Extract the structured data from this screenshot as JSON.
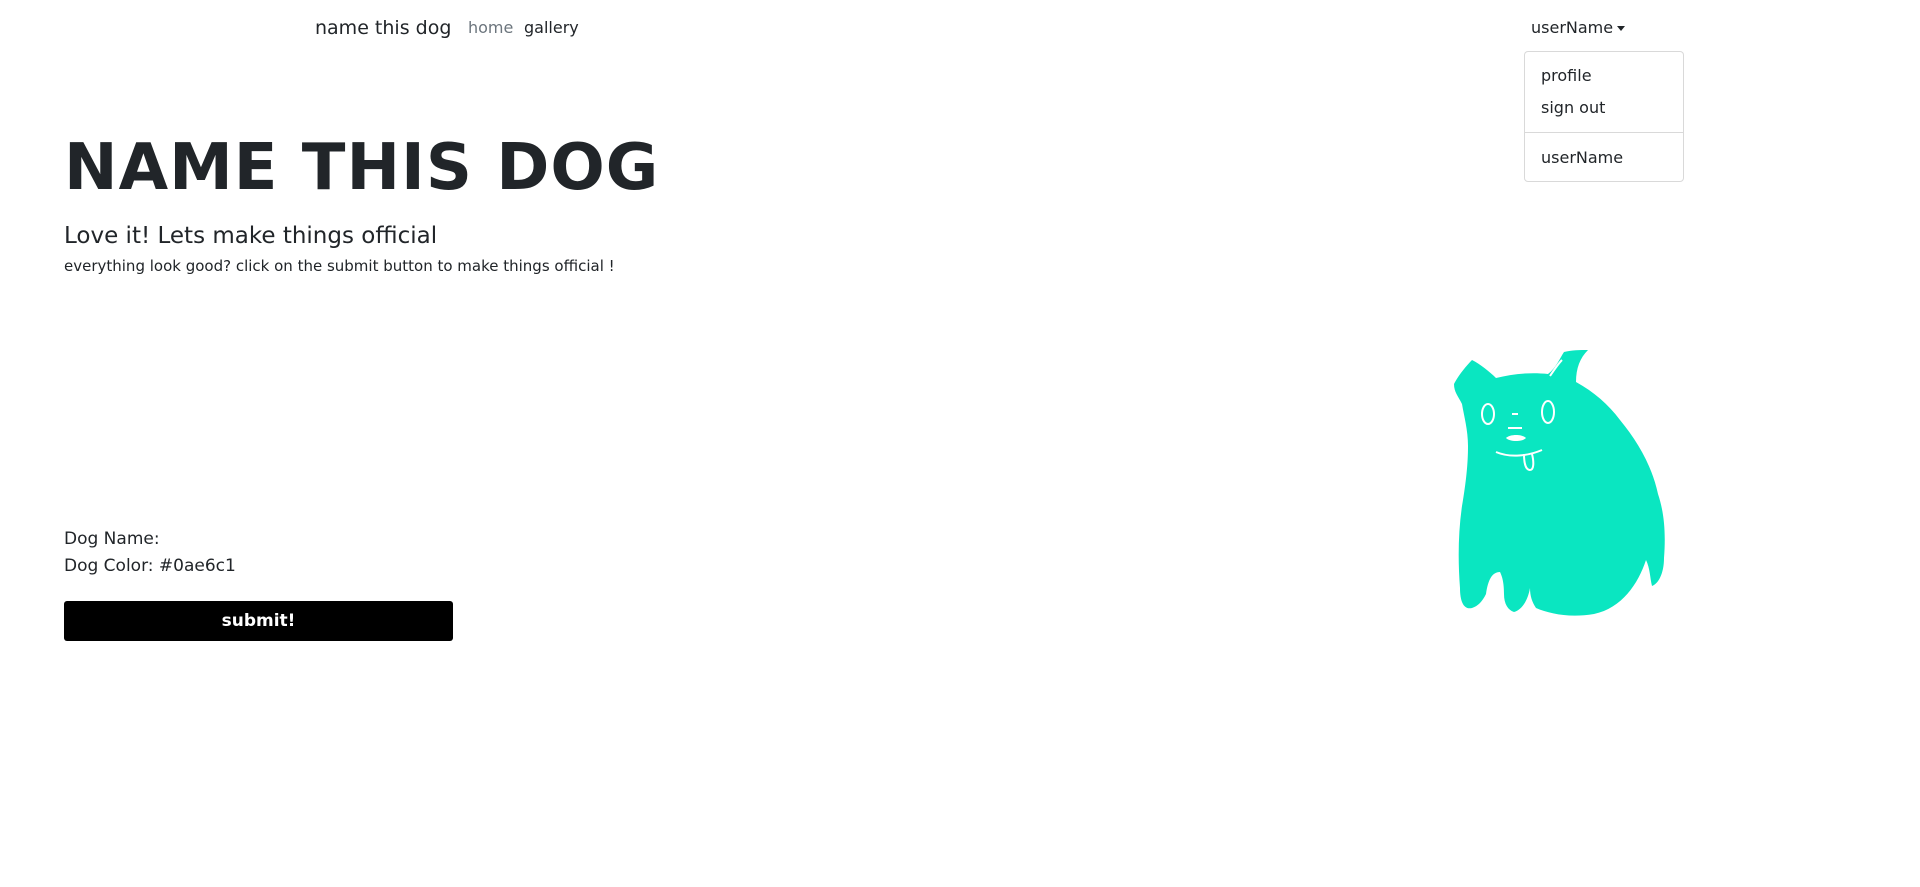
{
  "navbar": {
    "brand": "name this dog",
    "links": [
      "home",
      "gallery"
    ],
    "user_menu": {
      "toggle_label": "userName",
      "items": [
        "profile",
        "sign out"
      ],
      "footer_label": "userName"
    }
  },
  "hero": {
    "title": "NAME THIS DOG",
    "lead": "Love it! Lets make things official",
    "instructions": "everything look good? click on the submit button to make things official !"
  },
  "summary": {
    "dog_name": "Dog Name:",
    "dog_color": "Dog Color: #0ae6c1"
  },
  "submit_label": "submit!",
  "dog_illustration": {
    "icon": "dog-icon",
    "color": "#0ae6c1"
  }
}
